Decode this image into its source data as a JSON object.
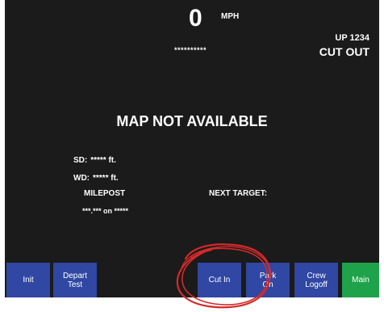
{
  "speed": {
    "value": "0",
    "unit": "MPH",
    "masked": "**********"
  },
  "locomotive": {
    "id": "UP 1234",
    "status": "CUT OUT"
  },
  "map": {
    "message": "MAP NOT AVAILABLE"
  },
  "info": {
    "sd_label": "SD:",
    "sd_value": "***** ft.",
    "wd_label": "WD:",
    "wd_value": "***** ft.",
    "milepost_label": "MILEPOST",
    "next_target_label": "NEXT TARGET:",
    "milepost_value": "***.*** on *****"
  },
  "softkeys": {
    "init": "Init",
    "depart_test": "Depart\nTest",
    "cut_in": "Cut In",
    "park_on": "Park\nOn",
    "crew_logoff": "Crew\nLogoff",
    "main": "Main"
  },
  "colors": {
    "screen_bg": "#1b1b1b",
    "softkey_blue": "#3047a3",
    "softkey_green": "#1fa34a",
    "annotation_red": "#d42a2a"
  }
}
